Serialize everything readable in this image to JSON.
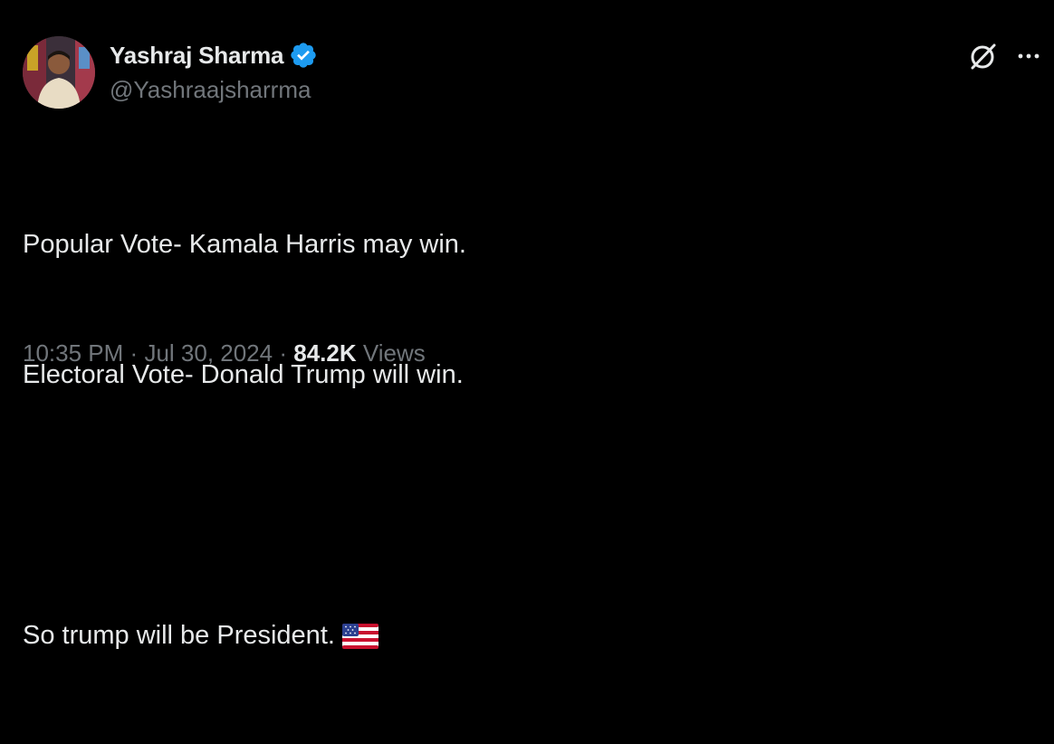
{
  "author": {
    "display_name": "Yashraj Sharma",
    "handle": "@Yashraajsharrma",
    "verified": true,
    "verified_color": "#1d9bf0"
  },
  "header_actions": {
    "grok_icon": "grok-icon",
    "more_icon": "more-horizontal-icon"
  },
  "tweet": {
    "lines": [
      "Popular Vote- Kamala Harris may win.",
      "Electoral Vote- Donald Trump will win.",
      "",
      "So trump will be President."
    ],
    "emoji": "us-flag-icon"
  },
  "meta": {
    "time": "10:35 PM",
    "separator": "·",
    "date": "Jul 30, 2024",
    "views_count": "84.2K",
    "views_label": "Views"
  },
  "colors": {
    "background": "#000000",
    "primary_text": "#e7e9ea",
    "secondary_text": "#71767b"
  }
}
